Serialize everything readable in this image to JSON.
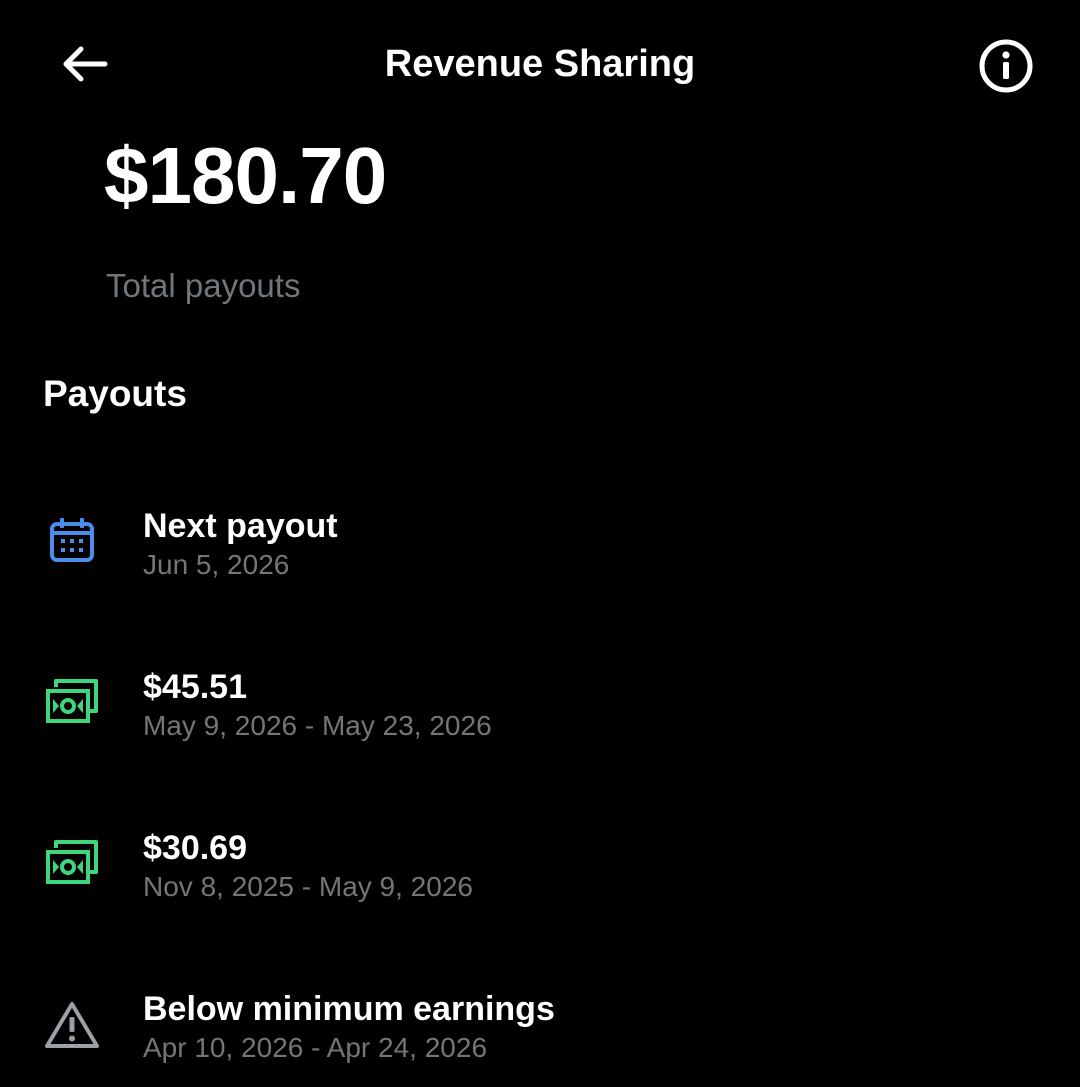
{
  "header": {
    "title": "Revenue Sharing",
    "back_icon": "arrow-left-icon",
    "info_icon": "info-circle-icon"
  },
  "summary": {
    "total_amount": "$180.70",
    "total_label": "Total payouts"
  },
  "payouts": {
    "section_title": "Payouts",
    "items": [
      {
        "icon": "calendar-icon",
        "title": "Next payout",
        "subtitle": "Jun 5, 2026",
        "icon_color": "#4c8dea"
      },
      {
        "icon": "money-bills-icon",
        "title": "$45.51",
        "subtitle": "May 9, 2026 - May 23, 2026",
        "icon_color": "#3ed67d"
      },
      {
        "icon": "money-bills-icon",
        "title": "$30.69",
        "subtitle": "Nov 8, 2025 - May 9, 2026",
        "icon_color": "#3ed67d"
      },
      {
        "icon": "warning-triangle-icon",
        "title": "Below minimum earnings",
        "subtitle": "Apr 10, 2026 - Apr 24, 2026",
        "icon_color": "#9aa0a6"
      }
    ]
  },
  "colors": {
    "background": "#000000",
    "text_primary": "#ffffff",
    "text_secondary": "#71767b"
  }
}
